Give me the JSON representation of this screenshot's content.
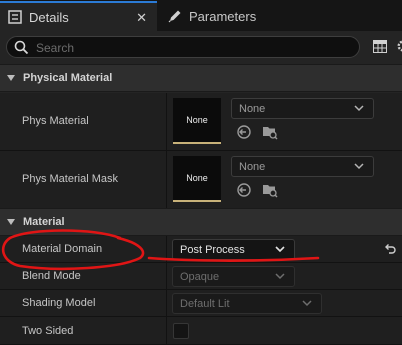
{
  "tabs": [
    {
      "label": "Details",
      "active": true
    },
    {
      "label": "Parameters",
      "active": false
    }
  ],
  "search": {
    "placeholder": "Search"
  },
  "sections": {
    "physical_material": {
      "title": "Physical Material",
      "rows": [
        {
          "name": "Phys Material",
          "thumb_text": "None",
          "value": "None"
        },
        {
          "name": "Phys Material Mask",
          "thumb_text": "None",
          "value": "None"
        }
      ]
    },
    "material": {
      "title": "Material",
      "rows": [
        {
          "name": "Material Domain",
          "value": "Post Process"
        },
        {
          "name": "Blend Mode",
          "value": "Opaque"
        },
        {
          "name": "Shading Model",
          "value": "Default Lit"
        },
        {
          "name": "Two Sided",
          "checked": false
        }
      ]
    }
  },
  "colors": {
    "active_tab_accent": "#2b7bd6",
    "annotation_red": "#e01515",
    "thumb_accent": "#c8b27a"
  }
}
